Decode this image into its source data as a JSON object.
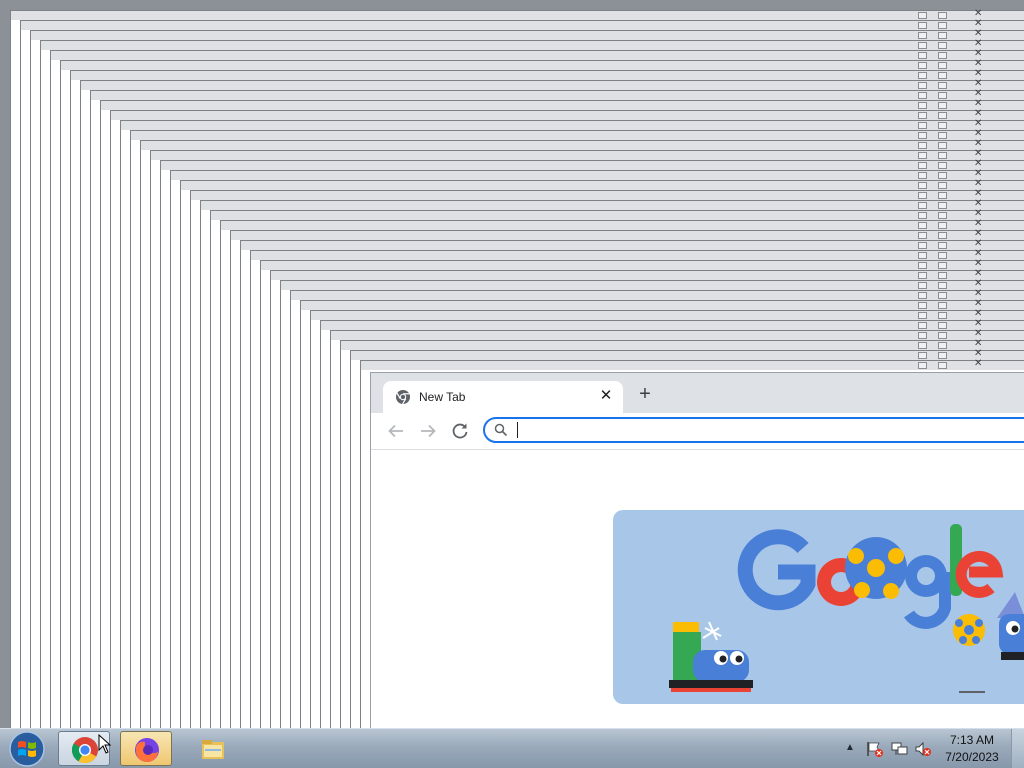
{
  "browser": {
    "tab": {
      "title": "New Tab",
      "close_label": "✕"
    },
    "new_tab_label": "+",
    "toolbar": {
      "back_icon": "back-arrow-icon",
      "forward_icon": "forward-arrow-icon",
      "reload_icon": "reload-icon"
    },
    "omnibox": {
      "value": "",
      "placeholder": ""
    },
    "doodle": {
      "colors": {
        "background": "#a8c7e8",
        "blue": "#4a7fd8",
        "red": "#ea4335",
        "yellow": "#fbbc04",
        "green": "#34a853"
      }
    }
  },
  "taskbar": {
    "apps": [
      {
        "name": "Google Chrome",
        "icon": "chrome-icon",
        "active": true
      },
      {
        "name": "Firefox",
        "icon": "firefox-icon",
        "active": false
      },
      {
        "name": "Windows Explorer",
        "icon": "folder-icon",
        "active": false
      }
    ],
    "tray": {
      "icons": [
        "action-center-error-icon",
        "network-icon",
        "volume-muted-icon"
      ],
      "time": "7:13 AM",
      "date": "7/20/2023"
    }
  },
  "colors": {
    "accent": "#1a73e8",
    "tabstrip": "#dee1e6",
    "taskbar": "#9aaabb"
  }
}
